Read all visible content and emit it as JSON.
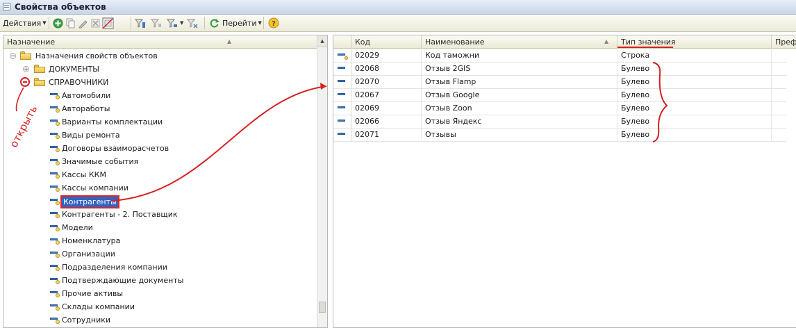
{
  "window": {
    "title": "Свойства объектов"
  },
  "toolbar": {
    "actions_label": "Действия",
    "goto_label": "Перейти",
    "icons": [
      "add-icon",
      "copy-icon",
      "edit-icon",
      "delete-icon",
      "mark-deleted-icon",
      "filter-icon",
      "filter-clear-icon",
      "filter-dropdown-icon",
      "filter-off-icon",
      "refresh-icon",
      "help-icon"
    ]
  },
  "left_panel": {
    "header": "Назначение",
    "root": "Назначения свойств объектов",
    "groups": [
      {
        "label": "ДОКУМЕНТЫ",
        "expanded": false
      },
      {
        "label": "СПРАВОЧНИКИ",
        "expanded": true
      }
    ],
    "items": [
      "Автомобили",
      "Автоработы",
      "Варианты комплектации",
      "Виды ремонта",
      "Договоры взаиморасчетов",
      "Значимые события",
      "Кассы ККМ",
      "Кассы компании",
      "Контрагенты",
      "Контрагенты - 2. Поставщик",
      "Модели",
      "Номенклатура",
      "Организации",
      "Подразделения компании",
      "Подтверждающие документы",
      "Прочие активы",
      "Склады компании",
      "Сотрудники"
    ],
    "selected_item": "Контрагенты",
    "annotation": "открыть"
  },
  "right_panel": {
    "columns": [
      "Код",
      "Наименование",
      "Тип значения",
      "Префи"
    ],
    "rows": [
      {
        "code": "02029",
        "name": "Код таможни",
        "type": "Строка"
      },
      {
        "code": "02068",
        "name": "Отзыв 2GIS",
        "type": "Булево"
      },
      {
        "code": "02070",
        "name": "Отзыв Flamp",
        "type": "Булево"
      },
      {
        "code": "02067",
        "name": "Отзыв Google",
        "type": "Булево"
      },
      {
        "code": "02069",
        "name": "Отзыв Zoon",
        "type": "Булево"
      },
      {
        "code": "02066",
        "name": "Отзыв Яндекс",
        "type": "Булево"
      },
      {
        "code": "02071",
        "name": "Отзывы",
        "type": "Булево"
      }
    ]
  },
  "colors": {
    "selection": "#3164c1",
    "annotation_red": "#d62020",
    "toolbar_bg": "#ecebd9"
  }
}
